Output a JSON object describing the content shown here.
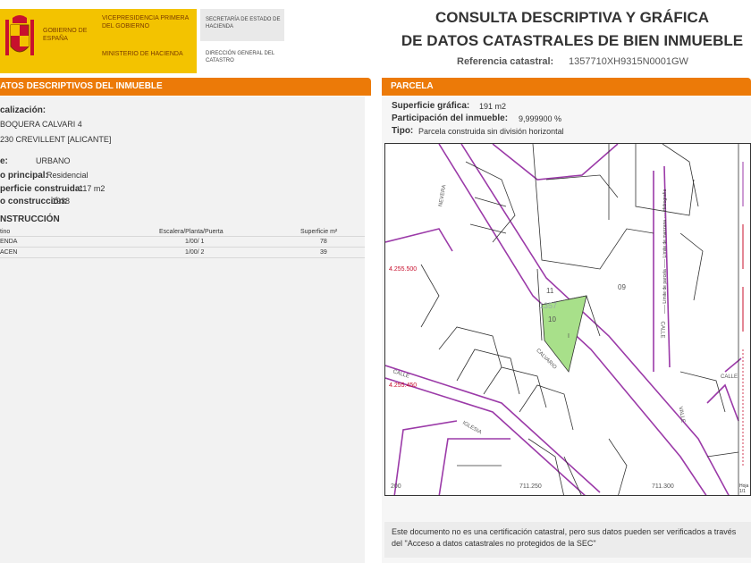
{
  "header": {
    "gobierno": "GOBIERNO DE ESPAÑA",
    "vicepresidencia": "VICEPRESIDENCIA PRIMERA DEL GOBIERNO",
    "ministerio": "MINISTERIO DE HACIENDA",
    "secretaria": "SECRETARÍA DE ESTADO DE HACIENDA",
    "direccion": "DIRECCIÓN GENERAL DEL CATASTRO",
    "title_line1": "CONSULTA DESCRIPTIVA Y GRÁFICA",
    "title_line2": "DE DATOS CATASTRALES DE BIEN INMUEBLE",
    "ref_label": "Referencia catastral:",
    "ref_value": "1357710XH9315N0001GW"
  },
  "left": {
    "bar_title": "ATOS DESCRIPTIVOS DEL INMUEBLE",
    "localizacion_label": "calización:",
    "address1": "BOQUERA CALVARI 4",
    "address2": "230 CREVILLENT [ALICANTE]",
    "clase_label": "e:",
    "clase_value": "URBANO",
    "uso_label": "o principal:",
    "uso_value": "Residencial",
    "superficie_label": "perficie construida:",
    "superficie_value": "117 m2",
    "ano_label": "o construcción:",
    "ano_value": "1938",
    "construccion_label": "NSTRUCCIÓN",
    "table": {
      "headers": [
        "tino",
        "Escalera/Planta/Puerta",
        "Superficie m²"
      ],
      "rows": [
        [
          "ENDA",
          "1/00/ 1",
          "78"
        ],
        [
          "ACEN",
          "1/00/ 2",
          "39"
        ]
      ]
    }
  },
  "right": {
    "bar_title": "PARCELA",
    "sup_label": "Superficie gráfica:",
    "sup_value": "191 m2",
    "part_label": "Participación del inmueble:",
    "part_value": "9,999900 %",
    "tipo_label": "Tipo:",
    "tipo_value": "Parcela construida sin división horizontal",
    "map_labels": {
      "parcel_11": "11",
      "parcel_10": "10",
      "parcel_09": "09",
      "ref_short": "1357",
      "coord_top": "4.255.500",
      "coord_mid": "4.255.450",
      "x1": "200",
      "x2": "711.250",
      "x3": "711.300",
      "calle1": "CALLE",
      "calle2": "CALLE",
      "calle3": "CALLE",
      "calvario": "CALVARIO",
      "iglesia": "IGLESIA",
      "valle": "VALLE",
      "nevera": "NEVERA",
      "marcador_i": "I",
      "side_text": "—— Límite de parcela   —— Límite de manzana   ···· Hidrografía",
      "side_text2": "Hoja 1/1"
    },
    "notice": "Este documento no es una certificación catastral, pero sus datos pueden ser verificados a través del \"Acceso a datos catastrales no protegidos de la SEC\""
  },
  "colors": {
    "orange": "#ec7a08",
    "gov_yellow": "#f3c300",
    "parcel_fill": "#a8e08a",
    "map_line": "#9b3aa8"
  }
}
